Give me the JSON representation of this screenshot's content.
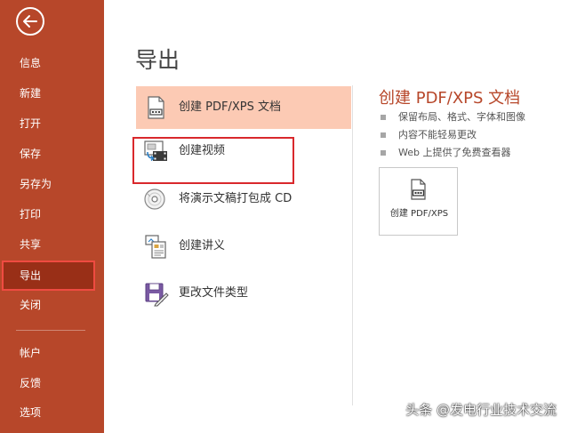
{
  "sidebar": {
    "back_icon": "arrow-left-icon",
    "items": [
      {
        "label": "信息"
      },
      {
        "label": "新建"
      },
      {
        "label": "打开"
      },
      {
        "label": "保存"
      },
      {
        "label": "另存为"
      },
      {
        "label": "打印"
      },
      {
        "label": "共享"
      },
      {
        "label": "导出",
        "active": true
      },
      {
        "label": "关闭"
      },
      {
        "label": "帐户"
      },
      {
        "label": "反馈"
      },
      {
        "label": "选项"
      }
    ]
  },
  "page": {
    "title": "导出"
  },
  "options": [
    {
      "label": "创建 PDF/XPS 文档",
      "icon": "pdf-document-icon",
      "selected": true
    },
    {
      "label": "创建视频",
      "icon": "video-icon",
      "highlighted": true
    },
    {
      "label": "将演示文稿打包成 CD",
      "icon": "cd-icon"
    },
    {
      "label": "创建讲义",
      "icon": "handout-icon"
    },
    {
      "label": "更改文件类型",
      "icon": "file-type-icon"
    }
  ],
  "detail": {
    "title": "创建 PDF/XPS 文档",
    "bullets": [
      "保留布局、格式、字体和图像",
      "内容不能轻易更改",
      "Web 上提供了免费查看器"
    ],
    "button_label": "创建 PDF/XPS",
    "button_icon": "pdf-document-icon"
  },
  "watermark": "头条 @发电行业技术交流",
  "colors": {
    "accent": "#b7472a",
    "selected_bg": "#fccab4",
    "highlight": "#d9282c"
  }
}
